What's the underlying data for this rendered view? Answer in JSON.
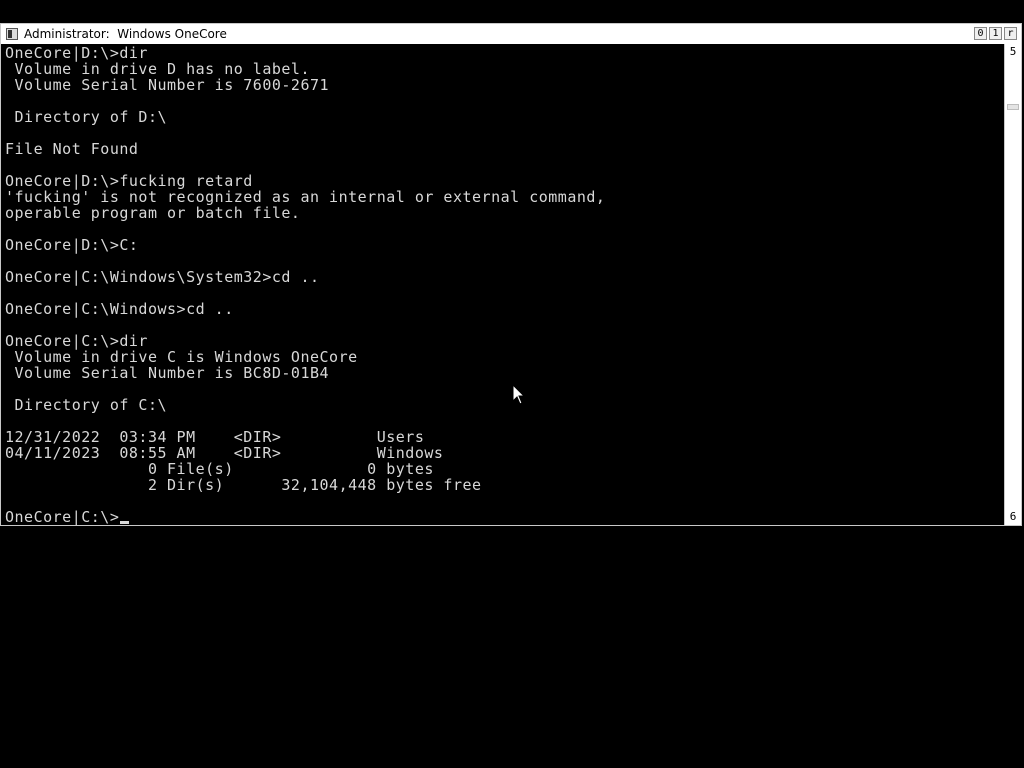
{
  "window": {
    "title": "Administrator:  Windows OneCore",
    "buttons": {
      "minimize": "0",
      "maximize": "1",
      "close": "r"
    }
  },
  "scrollbar": {
    "up_glyph": "5",
    "down_glyph": "6"
  },
  "console": {
    "lines": [
      "OneCore|D:\\>dir",
      " Volume in drive D has no label.",
      " Volume Serial Number is 7600-2671",
      "",
      " Directory of D:\\",
      "",
      "File Not Found",
      "",
      "OneCore|D:\\>fucking retard",
      "'fucking' is not recognized as an internal or external command,",
      "operable program or batch file.",
      "",
      "OneCore|D:\\>C:",
      "",
      "OneCore|C:\\Windows\\System32>cd ..",
      "",
      "OneCore|C:\\Windows>cd ..",
      "",
      "OneCore|C:\\>dir",
      " Volume in drive C is Windows OneCore",
      " Volume Serial Number is BC8D-01B4",
      "",
      " Directory of C:\\",
      "",
      "12/31/2022  03:34 PM    <DIR>          Users",
      "04/11/2023  08:55 AM    <DIR>          Windows",
      "               0 File(s)              0 bytes",
      "               2 Dir(s)      32,104,448 bytes free",
      ""
    ],
    "prompt": "OneCore|C:\\>"
  },
  "icons": {
    "window_icon": "console-icon",
    "pointer": "mouse-pointer-icon"
  },
  "colors": {
    "background": "#000000",
    "text": "#d8d8d8",
    "titlebar": "#ffffff"
  }
}
